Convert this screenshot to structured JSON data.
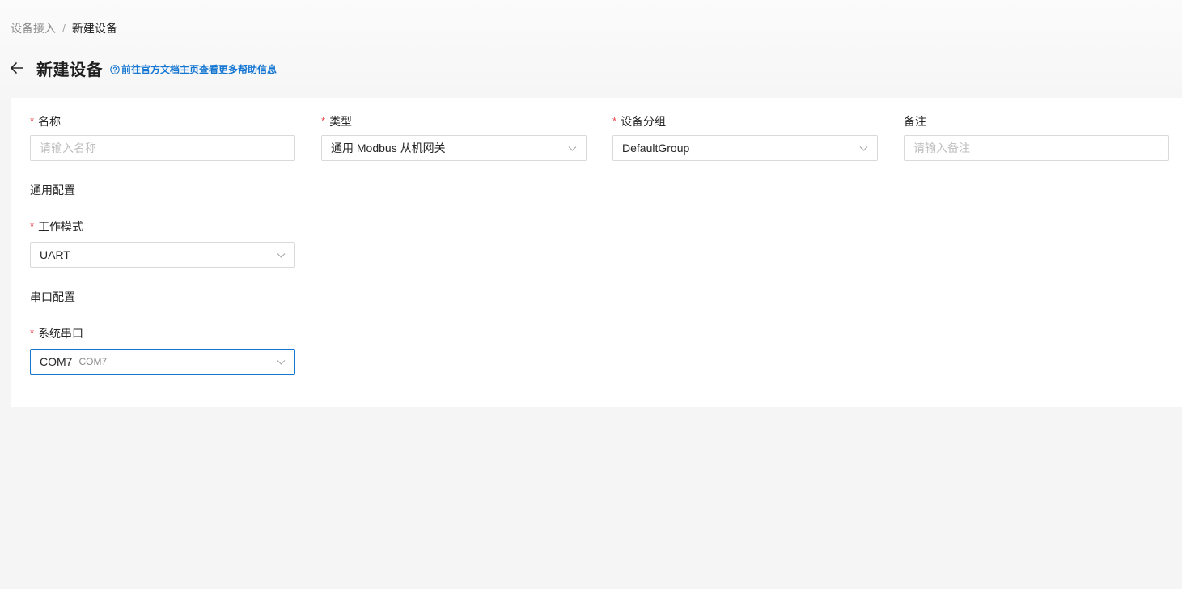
{
  "breadcrumb": {
    "parent": "设备接入",
    "separator": "/",
    "current": "新建设备"
  },
  "header": {
    "title": "新建设备",
    "help_link": "前往官方文档主页查看更多帮助信息"
  },
  "form": {
    "name": {
      "label": "名称",
      "required": "*",
      "placeholder": "请输入名称"
    },
    "type": {
      "label": "类型",
      "required": "*",
      "value": "通用 Modbus 从机网关"
    },
    "group": {
      "label": "设备分组",
      "required": "*",
      "value": "DefaultGroup"
    },
    "remark": {
      "label": "备注",
      "placeholder": "请输入备注"
    },
    "general_section": "通用配置",
    "work_mode": {
      "label": "工作模式",
      "required": "*",
      "value": "UART"
    },
    "serial_section": "串口配置",
    "serial_port": {
      "label": "系统串口",
      "required": "*",
      "value": "COM7",
      "sub": "COM7"
    }
  },
  "colors": {
    "accent": "#1677d2",
    "required": "#e5484d",
    "border": "#d9d9d9",
    "background": "#f5f5f5"
  },
  "icons": {
    "back": "arrow-left-icon",
    "help": "question-circle-icon",
    "dropdown": "chevron-down-icon"
  }
}
